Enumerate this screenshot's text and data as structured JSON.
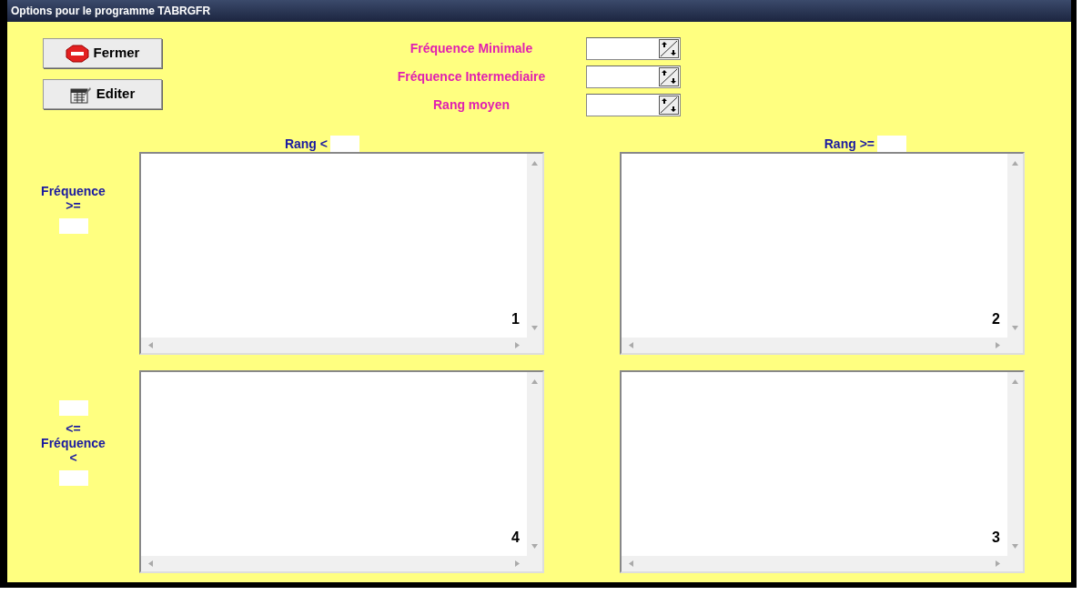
{
  "window": {
    "title": "Options pour le programme TABRGFR"
  },
  "buttons": [
    {
      "label": "Fermer",
      "kind": "stop"
    },
    {
      "label": "Editer",
      "kind": "edit"
    }
  ],
  "spin_fields": [
    {
      "label": "Fréquence Minimale"
    },
    {
      "label": "Fréquence Intermediaire"
    },
    {
      "label": "Rang moyen"
    }
  ],
  "rank_headers": [
    {
      "label": "Rang <"
    },
    {
      "label": "Rang >="
    }
  ],
  "frequency_labels": [
    {
      "lines_before_field": [
        "Fréquence",
        ">="
      ]
    },
    {
      "lines_middle": [
        "<=",
        "Fréquence",
        "<"
      ]
    }
  ],
  "list_boxes": [
    {
      "number": "1"
    },
    {
      "number": "2"
    },
    {
      "number": "4"
    },
    {
      "number": "3"
    }
  ]
}
